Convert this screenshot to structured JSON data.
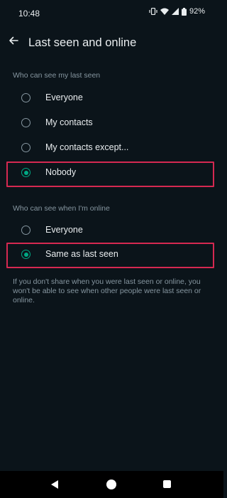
{
  "status_bar": {
    "time": "10:48",
    "battery": "92%",
    "icons": [
      "vibrate-icon",
      "wifi-icon",
      "signal-icon",
      "battery-icon"
    ]
  },
  "header": {
    "title": "Last seen and online",
    "back_icon": "arrow-left-icon"
  },
  "last_seen": {
    "header": "Who can see my last seen",
    "options": [
      {
        "label": "Everyone",
        "selected": false
      },
      {
        "label": "My contacts",
        "selected": false
      },
      {
        "label": "My contacts except...",
        "selected": false
      },
      {
        "label": "Nobody",
        "selected": true
      }
    ]
  },
  "online": {
    "header": "Who can see when I'm online",
    "options": [
      {
        "label": "Everyone",
        "selected": false
      },
      {
        "label": "Same as last seen",
        "selected": true
      }
    ]
  },
  "info_text": "If you don't share when you were last seen or online, you won't be able to see when other people were last seen or online.",
  "colors": {
    "background": "#0b141a",
    "accent": "#00a884",
    "highlight": "#d52951",
    "secondary_text": "#8696a0"
  }
}
